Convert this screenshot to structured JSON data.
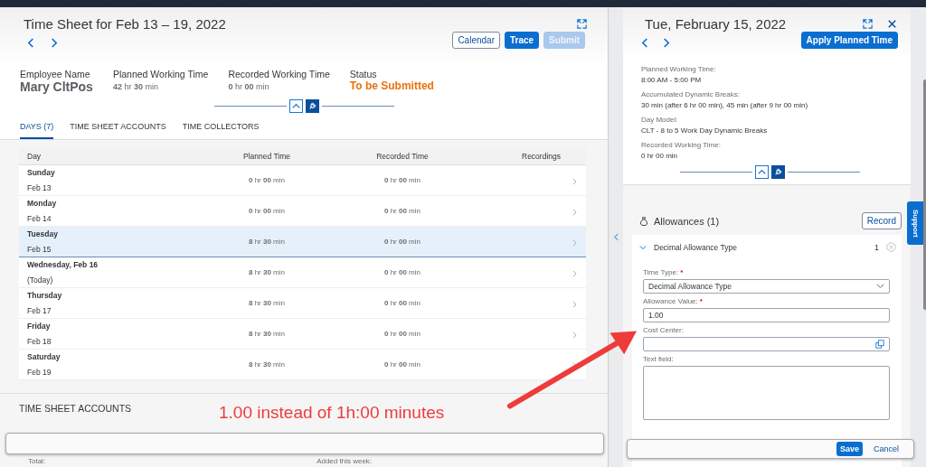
{
  "time_sheet": {
    "title": "Time Sheet for Feb 13 – 19, 2022",
    "buttons": [
      {
        "label": "Calendar",
        "kind": "outline",
        "disabled": false
      },
      {
        "label": "Trace",
        "kind": "primary",
        "disabled": false
      },
      {
        "label": "Submit",
        "kind": "primary",
        "disabled": true
      }
    ],
    "summary": [
      {
        "label": "Employee Name",
        "value": "Mary CltPos",
        "kind": "name"
      },
      {
        "label": "Planned Working Time",
        "value": "**42** hr  **30** min",
        "kind": "duration"
      },
      {
        "label": "Recorded Working Time",
        "value": "**0** hr  **00** min",
        "kind": "duration"
      },
      {
        "label": "Status",
        "value": "To be Submitted",
        "kind": "status"
      }
    ],
    "tabs": [
      {
        "label": "DAYS (7)",
        "selected": true
      },
      {
        "label": "TIME SHEET ACCOUNTS",
        "selected": false
      },
      {
        "label": "TIME COLLECTORS",
        "selected": false
      }
    ],
    "table": {
      "columns": [
        "Day",
        "Planned Time",
        "Recorded Time",
        "Recordings"
      ],
      "rows": [
        {
          "day": "Sunday",
          "date": "Feb 13",
          "planned": "**0** hr  **00** min",
          "recorded": "**0** hr  **00** min",
          "selected": false
        },
        {
          "day": "Monday",
          "date": "Feb 14",
          "planned": "**0** hr  **00** min",
          "recorded": "**0** hr  **00** min",
          "selected": false
        },
        {
          "day": "Tuesday",
          "date": "Feb 15",
          "planned": "**8** hr  **30** min",
          "recorded": "**0** hr  **00** min",
          "selected": true
        },
        {
          "day": "Wednesday, Feb 16",
          "date": "(Today)",
          "planned": "**8** hr  **30** min",
          "recorded": "**0** hr  **00** min",
          "selected": false
        },
        {
          "day": "Thursday",
          "date": "Feb 17",
          "planned": "**8** hr  **30** min",
          "recorded": "**0** hr  **00** min",
          "selected": false
        },
        {
          "day": "Friday",
          "date": "Feb 18",
          "planned": "**8** hr  **30** min",
          "recorded": "**0** hr  **00** min",
          "selected": false
        },
        {
          "day": "Saturday",
          "date": "Feb 19",
          "planned": "**8** hr  **30** min",
          "recorded": "**0** hr  **00** min",
          "selected": false
        }
      ]
    },
    "accounts": {
      "title": "TIME SHEET ACCOUNTS",
      "labels": [
        "Total:",
        "Added this week:"
      ]
    }
  },
  "annotation": {
    "text": "1.00 instead of 1h:00 minutes"
  },
  "day_detail": {
    "title": "Tue, February 15, 2022",
    "apply_button": "Apply Planned Time",
    "details": [
      {
        "label": "Planned Working Time:",
        "value": "8:00 AM - 5:00 PM"
      },
      {
        "label": "Accumulated Dynamic Breaks:",
        "value": "30 min (after 6 hr 00 min), 45 min (after 9 hr 00 min)"
      },
      {
        "label": "Day Model:",
        "value": "CLT - 8 to 5 Work Day Dynamic Breaks"
      },
      {
        "label": "Recorded Working Time:",
        "value": "0 hr 00 min"
      }
    ],
    "allowances": {
      "title": "Allowances (1)",
      "record_button": "Record",
      "item": {
        "title": "Decimal Allowance Type",
        "count": "1",
        "expanded": true,
        "fields": [
          {
            "label": "Time Type:",
            "required_mark": "*",
            "kind": "select",
            "value": "Decimal Allowance Type"
          },
          {
            "label": "Allowance Value:",
            "required_mark": "*",
            "kind": "input",
            "value": "1.00"
          },
          {
            "label": "Cost Center:",
            "kind": "valuehelp"
          },
          {
            "label": "Text field:",
            "kind": "textarea"
          }
        ]
      }
    },
    "footer_buttons": [
      {
        "label": "Save",
        "kind": "primary"
      },
      {
        "label": "Cancel",
        "kind": "text"
      }
    ]
  },
  "support_tab": "Support"
}
